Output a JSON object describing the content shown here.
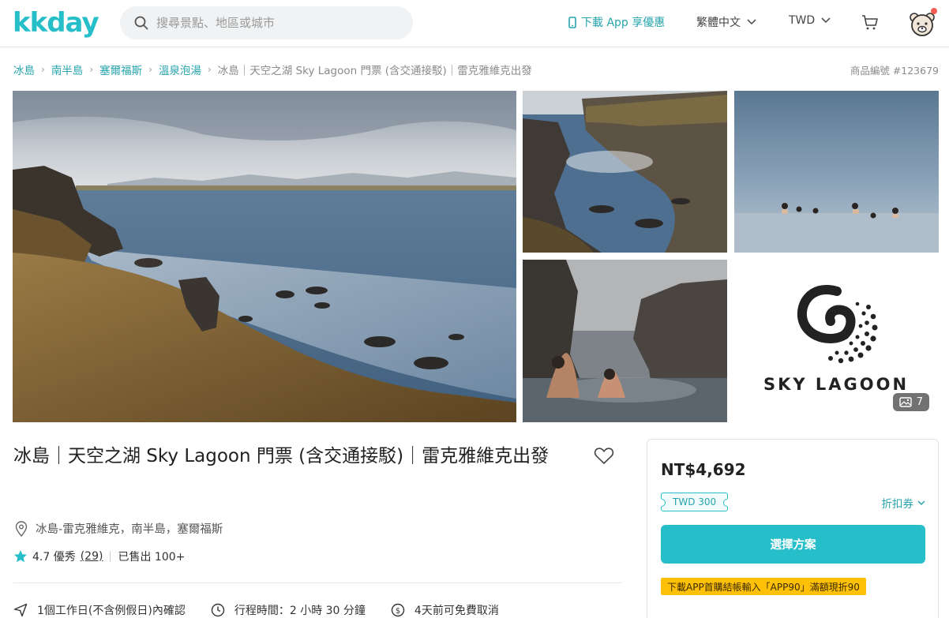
{
  "header": {
    "logo_text": "kkday",
    "search_placeholder": "搜尋景點、地區或城市",
    "app_download": "下載 App 享優惠",
    "language": "繁體中文",
    "currency": "TWD",
    "brand_color": "#26bec9"
  },
  "breadcrumb": {
    "items": [
      "冰島",
      "南半島",
      "塞爾福斯",
      "溫泉泡湯"
    ],
    "current": "冰島｜天空之湖 Sky Lagoon 門票 (含交通接駁)｜雷克雅維克出發",
    "product_id": "商品編號 #123679"
  },
  "gallery": {
    "photo_count": "7",
    "logo_text": "SKY LAGOON"
  },
  "product": {
    "title": "冰島｜天空之湖 Sky Lagoon 門票 (含交通接駁)｜雷克雅維克出發",
    "location": "冰島-雷克雅維克，南半島，塞爾福斯",
    "rating_value": "4.7 優秀",
    "rating_count": "(29)",
    "sold": "已售出 100+",
    "features": [
      {
        "icon": "send-icon",
        "text": "1個工作日(不含例假日)內確認"
      },
      {
        "icon": "clock-icon",
        "text": "行程時間：2 小時 30 分鐘"
      },
      {
        "icon": "dollar-icon",
        "text": "4天前可免費取消"
      }
    ]
  },
  "booking": {
    "price": "NT$4,692",
    "coupon": "TWD 300",
    "discount_link": "折扣券",
    "cta": "選擇方案",
    "promo": "下載APP首購結帳輸入「APP90」滿額現折90"
  }
}
